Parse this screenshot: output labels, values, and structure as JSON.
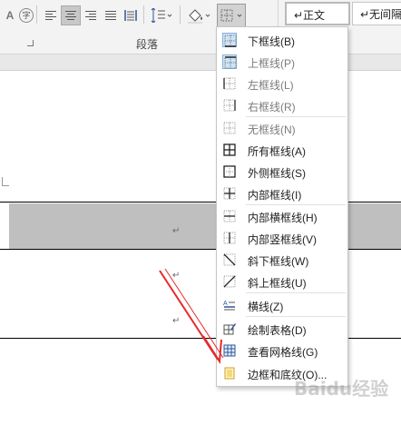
{
  "ribbon": {
    "group_label": "段落",
    "char_icon": "字",
    "styles": [
      {
        "label": "↵正文"
      },
      {
        "label": "↵无间隔"
      }
    ]
  },
  "document": {
    "para_marks": [
      "↵",
      "↵",
      "↵"
    ]
  },
  "border_menu": {
    "items": [
      {
        "label": "下框线(B)",
        "icon": "bottom-border-icon",
        "enabled": true
      },
      {
        "label": "上框线(P)",
        "icon": "top-border-icon",
        "enabled": false
      },
      {
        "label": "左框线(L)",
        "icon": "left-border-icon",
        "enabled": false
      },
      {
        "label": "右框线(R)",
        "icon": "right-border-icon",
        "enabled": false
      },
      {
        "label": "无框线(N)",
        "icon": "no-border-icon",
        "enabled": true
      },
      {
        "label": "所有框线(A)",
        "icon": "all-borders-icon",
        "enabled": true
      },
      {
        "label": "外侧框线(S)",
        "icon": "outside-borders-icon",
        "enabled": true
      },
      {
        "label": "内部框线(I)",
        "icon": "inside-borders-icon",
        "enabled": true
      },
      {
        "label": "内部横框线(H)",
        "icon": "inside-horizontal-border-icon",
        "enabled": true
      },
      {
        "label": "内部竖框线(V)",
        "icon": "inside-vertical-border-icon",
        "enabled": true
      },
      {
        "label": "斜下框线(W)",
        "icon": "diagonal-down-border-icon",
        "enabled": true
      },
      {
        "label": "斜上框线(U)",
        "icon": "diagonal-up-border-icon",
        "enabled": true
      },
      {
        "label": "横线(Z)",
        "icon": "horizontal-line-icon",
        "enabled": true
      },
      {
        "label": "绘制表格(D)",
        "icon": "draw-table-icon",
        "enabled": true
      },
      {
        "label": "查看网格线(G)",
        "icon": "view-gridlines-icon",
        "enabled": true
      },
      {
        "label": "边框和底纹(O)...",
        "icon": "borders-and-shading-icon",
        "enabled": true
      }
    ]
  },
  "watermark": "Baidu经验",
  "colors": {
    "arrow": "#e52a2a",
    "highlight": "#cde4f7",
    "table_gray": "#bfbfbf"
  }
}
